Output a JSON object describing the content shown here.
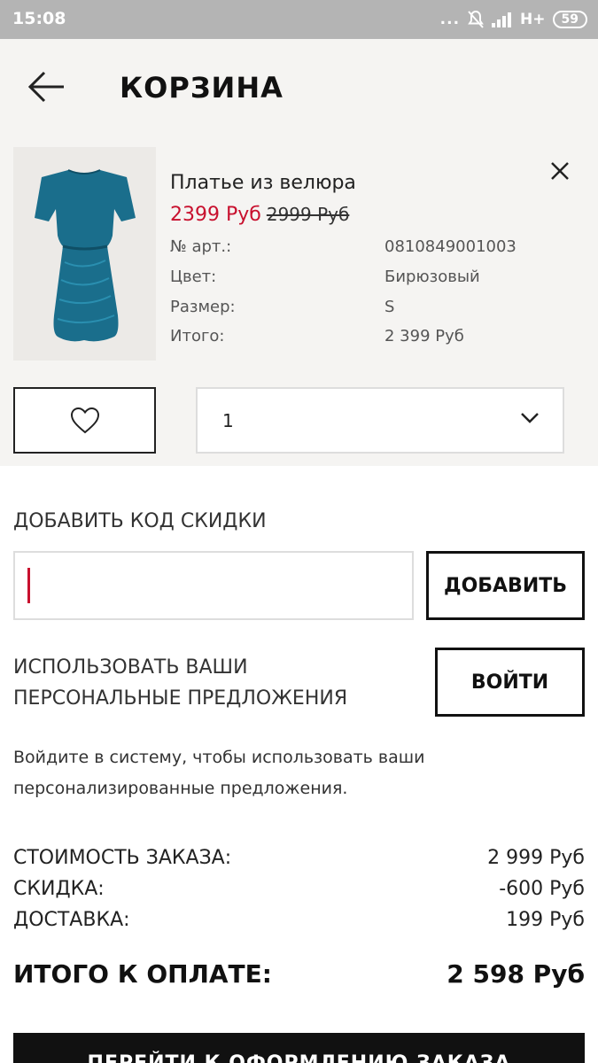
{
  "status_bar": {
    "time": "15:08",
    "dots": "...",
    "network": "H+",
    "battery": "59",
    "icons": [
      "mute-bell-icon",
      "signal-icon"
    ]
  },
  "header": {
    "title": "КОРЗИНА",
    "back_icon": "arrow-left-icon"
  },
  "cart_item": {
    "name": "Платье из велюра",
    "price_current": "2399 Руб",
    "price_old": "2999 Руб",
    "image_desc": "teal-velour-dress",
    "image_color": "#1a6e8c",
    "attributes": [
      {
        "label": "№ арт.:",
        "value": "0810849001003"
      },
      {
        "label": "Цвет:",
        "value": "Бирюзовый"
      },
      {
        "label": "Размер:",
        "value": "S"
      },
      {
        "label": "Итого:",
        "value": "2 399 Руб"
      }
    ],
    "quantity": "1",
    "remove_icon": "close-icon",
    "wishlist_icon": "heart-icon"
  },
  "discount": {
    "heading": "ДОБАВИТЬ КОД СКИДКИ",
    "input_value": "",
    "add_button": "ДОБАВИТЬ"
  },
  "offers": {
    "heading": "ИСПОЛЬЗОВАТЬ ВАШИ ПЕРСОНАЛЬНЫЕ ПРЕДЛОЖЕНИЯ",
    "login_button": "ВОЙТИ",
    "note": "Войдите в систему, чтобы использовать ваши персонализированные предложения."
  },
  "summary": {
    "rows": [
      {
        "label": "СТОИМОСТЬ ЗАКАЗА:",
        "value": "2 999 Руб"
      },
      {
        "label": "СКИДКА:",
        "value": "-600 Руб"
      },
      {
        "label": "ДОСТАВКА:",
        "value": "199 Руб"
      }
    ],
    "total_label": "ИТОГО К ОПЛАТЕ:",
    "total_value": "2 598 Руб"
  },
  "checkout": {
    "button": "ПЕРЕЙТИ К ОФОРМЛЕНИЮ ЗАКАЗА"
  },
  "colors": {
    "accent_red": "#c8102e",
    "status_bar": "#b4b4b4",
    "cart_bg": "#f5f4f2"
  }
}
